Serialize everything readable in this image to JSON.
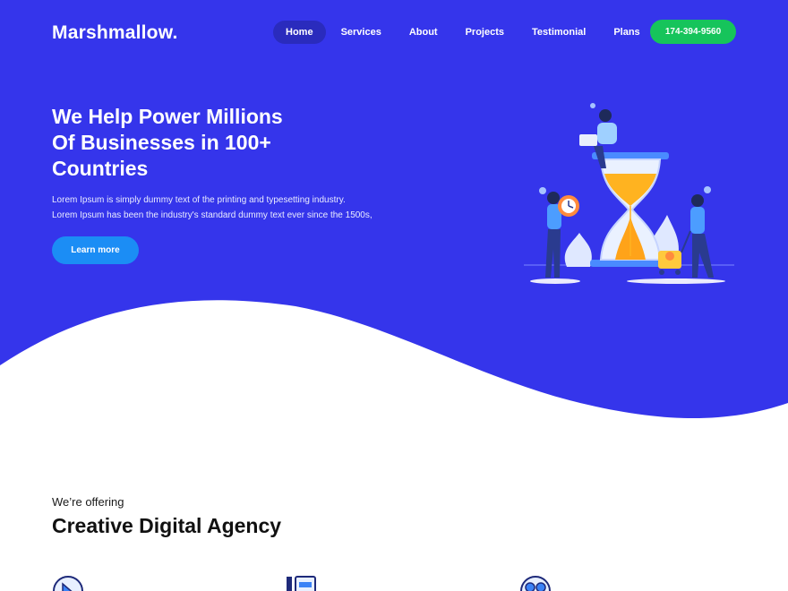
{
  "colors": {
    "hero_bg": "#3535eb",
    "nav_active": "#2a2bbd",
    "phone_btn": "#16c45b",
    "learn_btn": "#1b8df5"
  },
  "nav": {
    "brand": "Marshmallow.",
    "items": [
      {
        "label": "Home",
        "active": true
      },
      {
        "label": "Services"
      },
      {
        "label": "About"
      },
      {
        "label": "Projects"
      },
      {
        "label": "Testimonial"
      },
      {
        "label": "Plans"
      }
    ],
    "phone": "174-394-9560"
  },
  "hero": {
    "title_lines": [
      "We Help Power Millions",
      "Of Businesses in 100+",
      "Countries"
    ],
    "desc_lines": [
      "Lorem Ipsum is simply dummy text of the printing and typesetting industry.",
      "Lorem Ipsum has been the industry's standard dummy text ever since the 1500s,"
    ],
    "cta": "Learn more",
    "illustration": "hourglass-team-illustration"
  },
  "offering": {
    "eyebrow": "We’re offering",
    "title": "Creative Digital Agency",
    "icons": [
      "cursor-click-icon",
      "document-icon",
      "film-reel-icon"
    ]
  }
}
